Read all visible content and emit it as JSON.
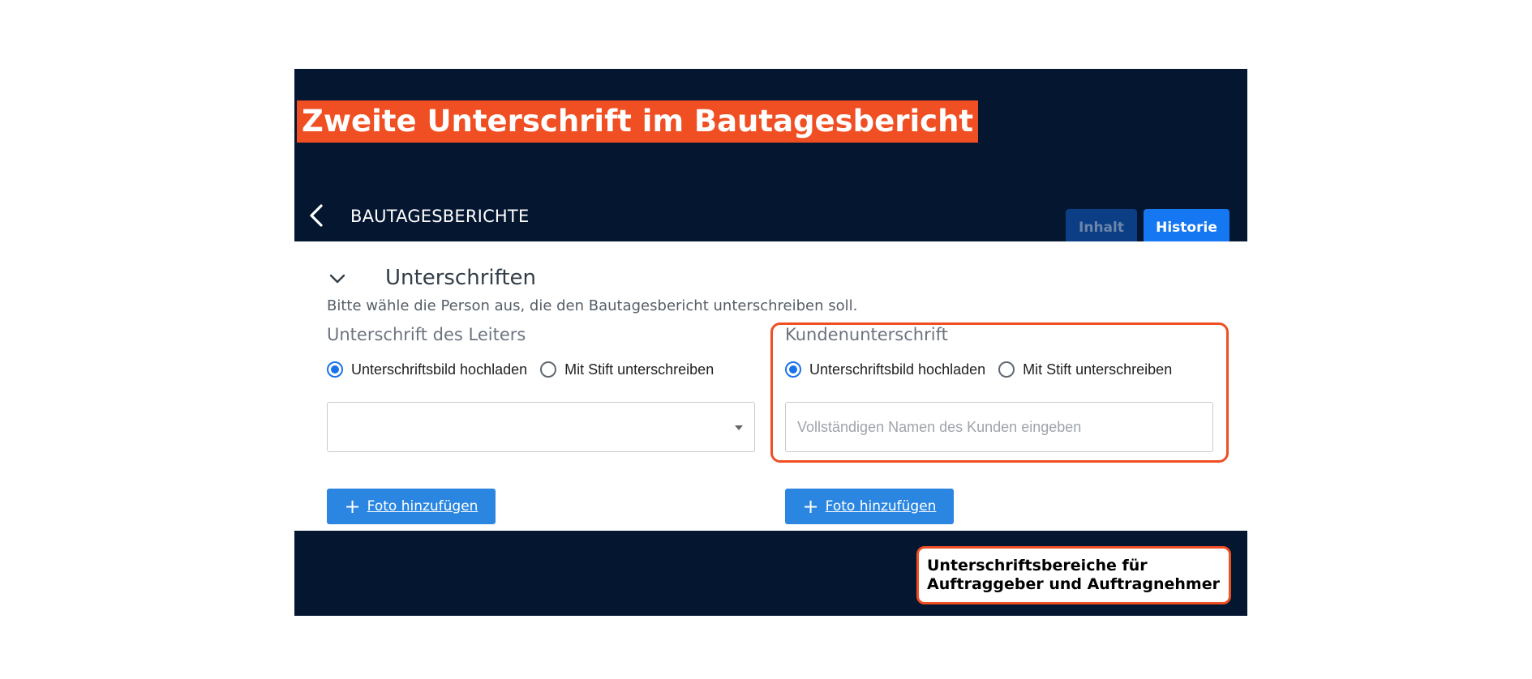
{
  "headline": "Zweite Unterschrift im Bautagesbericht",
  "appbar": {
    "title": "BAUTAGESBERICHTE",
    "tabs": {
      "inhalt": "Inhalt",
      "historie": "Historie"
    }
  },
  "section": {
    "title": "Unterschriften",
    "description": "Bitte wähle die Person aus, die den Bautagesbericht unterschreiben soll."
  },
  "leader": {
    "heading": "Unterschrift des Leiters",
    "radio_upload": "Unterschriftsbild hochladen",
    "radio_pen": "Mit Stift unterschreiben",
    "selected": "upload",
    "select_value": "",
    "photo_button": "Foto hinzufügen"
  },
  "customer": {
    "heading": "Kundenunterschrift",
    "radio_upload": "Unterschriftsbild hochladen",
    "radio_pen": "Mit Stift unterschreiben",
    "selected": "upload",
    "name_placeholder": "Vollständigen Namen des Kunden eingeben",
    "name_value": "",
    "photo_button": "Foto hinzufügen"
  },
  "callout": {
    "line1": "Unterschriftsbereiche für",
    "line2": "Auftraggeber und Auftragnehmer"
  },
  "colors": {
    "navy": "#041630",
    "accent": "#f04e23",
    "primary": "#1577f2",
    "button_blue": "#2a86e0"
  },
  "icons": {
    "back": "chevron-left-icon",
    "section_toggle": "chevron-down-icon",
    "add": "plus-icon",
    "dropdown": "caret-down-icon"
  }
}
